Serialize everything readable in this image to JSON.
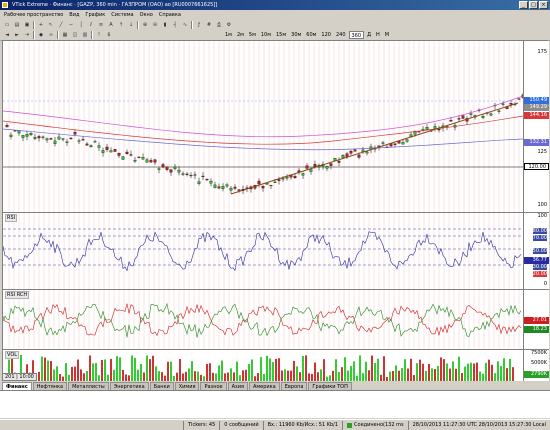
{
  "window": {
    "title": "VTick Extreme · Финанс · [GAZP, 360 min · ГАЗПРОМ (ОАО) ао [RU0007661625]]"
  },
  "menu": [
    "Рабочее пространство",
    "Вид",
    "График",
    "Система",
    "Окно",
    "Справка"
  ],
  "timeframes": [
    "1м",
    "2м",
    "5м",
    "10м",
    "15м",
    "30м",
    "60м",
    "120",
    "240",
    "360",
    "Д",
    "Н",
    "М"
  ],
  "active_timeframe": "360",
  "price_pane": {
    "ticks": [
      "175",
      "150",
      "125",
      "100"
    ],
    "tags": [
      {
        "value": "150.49",
        "color": "#2f6fdf"
      },
      {
        "value": "149.29",
        "color": "#8c8c8c"
      },
      {
        "value": "144.16",
        "color": "#d43a3a"
      },
      {
        "value": "132.31",
        "color": "#6a6ad0"
      },
      {
        "value": "120.00",
        "color": "#ffffff"
      }
    ]
  },
  "rsi_pane": {
    "label": "RSI",
    "ticks": [
      "100",
      "80.00",
      "70.00",
      "50.00",
      "30.00",
      "20.00",
      "0"
    ],
    "tags": [
      {
        "value": "36.77",
        "color": "#2a2aa0"
      }
    ]
  },
  "rsi2_pane": {
    "label": "RSI RCH",
    "tags": [
      {
        "value": "27.01",
        "color": "#cc2020"
      },
      {
        "value": "18.23",
        "color": "#228822"
      }
    ]
  },
  "vol_pane": {
    "label": "VOL",
    "ticks": [
      "7500K",
      "5000K",
      "2500K"
    ],
    "tags": [
      {
        "value": "2790K",
        "color": "#2aa02a"
      }
    ]
  },
  "time_axis": {
    "labels": [
      "201",
      "10:00"
    ]
  },
  "tabs": [
    "Финанс",
    "Нефтянка",
    "Металлисты",
    "Энергетика",
    "Банки",
    "Химия",
    "Разное",
    "Азия",
    "Америка",
    "Европа",
    "Графики ТОП"
  ],
  "active_tab": "Финанс",
  "status": {
    "tickers": "Tickers: 45",
    "messages": "0 сообщений",
    "traffic": "Вх.: 11960 Kb/Исх.: 51 Kb/1",
    "connection": "Соединено(132 ms",
    "time": "28/10/2013 11:27:30 UTC   28/10/2013 15:27:30 Local"
  }
}
